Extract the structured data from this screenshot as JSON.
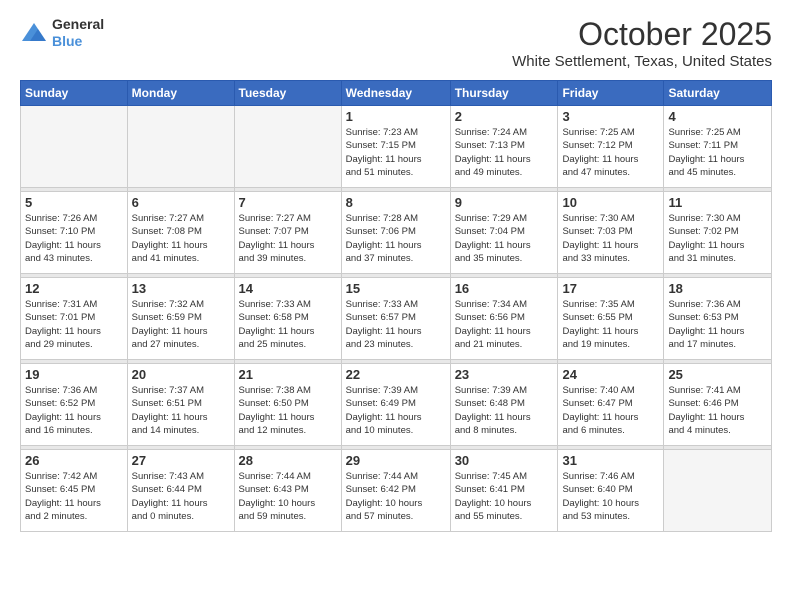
{
  "logo": {
    "general": "General",
    "blue": "Blue"
  },
  "header": {
    "month": "October 2025",
    "location": "White Settlement, Texas, United States"
  },
  "days_of_week": [
    "Sunday",
    "Monday",
    "Tuesday",
    "Wednesday",
    "Thursday",
    "Friday",
    "Saturday"
  ],
  "weeks": [
    [
      {
        "num": "",
        "info": ""
      },
      {
        "num": "",
        "info": ""
      },
      {
        "num": "",
        "info": ""
      },
      {
        "num": "1",
        "info": "Sunrise: 7:23 AM\nSunset: 7:15 PM\nDaylight: 11 hours\nand 51 minutes."
      },
      {
        "num": "2",
        "info": "Sunrise: 7:24 AM\nSunset: 7:13 PM\nDaylight: 11 hours\nand 49 minutes."
      },
      {
        "num": "3",
        "info": "Sunrise: 7:25 AM\nSunset: 7:12 PM\nDaylight: 11 hours\nand 47 minutes."
      },
      {
        "num": "4",
        "info": "Sunrise: 7:25 AM\nSunset: 7:11 PM\nDaylight: 11 hours\nand 45 minutes."
      }
    ],
    [
      {
        "num": "5",
        "info": "Sunrise: 7:26 AM\nSunset: 7:10 PM\nDaylight: 11 hours\nand 43 minutes."
      },
      {
        "num": "6",
        "info": "Sunrise: 7:27 AM\nSunset: 7:08 PM\nDaylight: 11 hours\nand 41 minutes."
      },
      {
        "num": "7",
        "info": "Sunrise: 7:27 AM\nSunset: 7:07 PM\nDaylight: 11 hours\nand 39 minutes."
      },
      {
        "num": "8",
        "info": "Sunrise: 7:28 AM\nSunset: 7:06 PM\nDaylight: 11 hours\nand 37 minutes."
      },
      {
        "num": "9",
        "info": "Sunrise: 7:29 AM\nSunset: 7:04 PM\nDaylight: 11 hours\nand 35 minutes."
      },
      {
        "num": "10",
        "info": "Sunrise: 7:30 AM\nSunset: 7:03 PM\nDaylight: 11 hours\nand 33 minutes."
      },
      {
        "num": "11",
        "info": "Sunrise: 7:30 AM\nSunset: 7:02 PM\nDaylight: 11 hours\nand 31 minutes."
      }
    ],
    [
      {
        "num": "12",
        "info": "Sunrise: 7:31 AM\nSunset: 7:01 PM\nDaylight: 11 hours\nand 29 minutes."
      },
      {
        "num": "13",
        "info": "Sunrise: 7:32 AM\nSunset: 6:59 PM\nDaylight: 11 hours\nand 27 minutes."
      },
      {
        "num": "14",
        "info": "Sunrise: 7:33 AM\nSunset: 6:58 PM\nDaylight: 11 hours\nand 25 minutes."
      },
      {
        "num": "15",
        "info": "Sunrise: 7:33 AM\nSunset: 6:57 PM\nDaylight: 11 hours\nand 23 minutes."
      },
      {
        "num": "16",
        "info": "Sunrise: 7:34 AM\nSunset: 6:56 PM\nDaylight: 11 hours\nand 21 minutes."
      },
      {
        "num": "17",
        "info": "Sunrise: 7:35 AM\nSunset: 6:55 PM\nDaylight: 11 hours\nand 19 minutes."
      },
      {
        "num": "18",
        "info": "Sunrise: 7:36 AM\nSunset: 6:53 PM\nDaylight: 11 hours\nand 17 minutes."
      }
    ],
    [
      {
        "num": "19",
        "info": "Sunrise: 7:36 AM\nSunset: 6:52 PM\nDaylight: 11 hours\nand 16 minutes."
      },
      {
        "num": "20",
        "info": "Sunrise: 7:37 AM\nSunset: 6:51 PM\nDaylight: 11 hours\nand 14 minutes."
      },
      {
        "num": "21",
        "info": "Sunrise: 7:38 AM\nSunset: 6:50 PM\nDaylight: 11 hours\nand 12 minutes."
      },
      {
        "num": "22",
        "info": "Sunrise: 7:39 AM\nSunset: 6:49 PM\nDaylight: 11 hours\nand 10 minutes."
      },
      {
        "num": "23",
        "info": "Sunrise: 7:39 AM\nSunset: 6:48 PM\nDaylight: 11 hours\nand 8 minutes."
      },
      {
        "num": "24",
        "info": "Sunrise: 7:40 AM\nSunset: 6:47 PM\nDaylight: 11 hours\nand 6 minutes."
      },
      {
        "num": "25",
        "info": "Sunrise: 7:41 AM\nSunset: 6:46 PM\nDaylight: 11 hours\nand 4 minutes."
      }
    ],
    [
      {
        "num": "26",
        "info": "Sunrise: 7:42 AM\nSunset: 6:45 PM\nDaylight: 11 hours\nand 2 minutes."
      },
      {
        "num": "27",
        "info": "Sunrise: 7:43 AM\nSunset: 6:44 PM\nDaylight: 11 hours\nand 0 minutes."
      },
      {
        "num": "28",
        "info": "Sunrise: 7:44 AM\nSunset: 6:43 PM\nDaylight: 10 hours\nand 59 minutes."
      },
      {
        "num": "29",
        "info": "Sunrise: 7:44 AM\nSunset: 6:42 PM\nDaylight: 10 hours\nand 57 minutes."
      },
      {
        "num": "30",
        "info": "Sunrise: 7:45 AM\nSunset: 6:41 PM\nDaylight: 10 hours\nand 55 minutes."
      },
      {
        "num": "31",
        "info": "Sunrise: 7:46 AM\nSunset: 6:40 PM\nDaylight: 10 hours\nand 53 minutes."
      },
      {
        "num": "",
        "info": ""
      }
    ]
  ]
}
